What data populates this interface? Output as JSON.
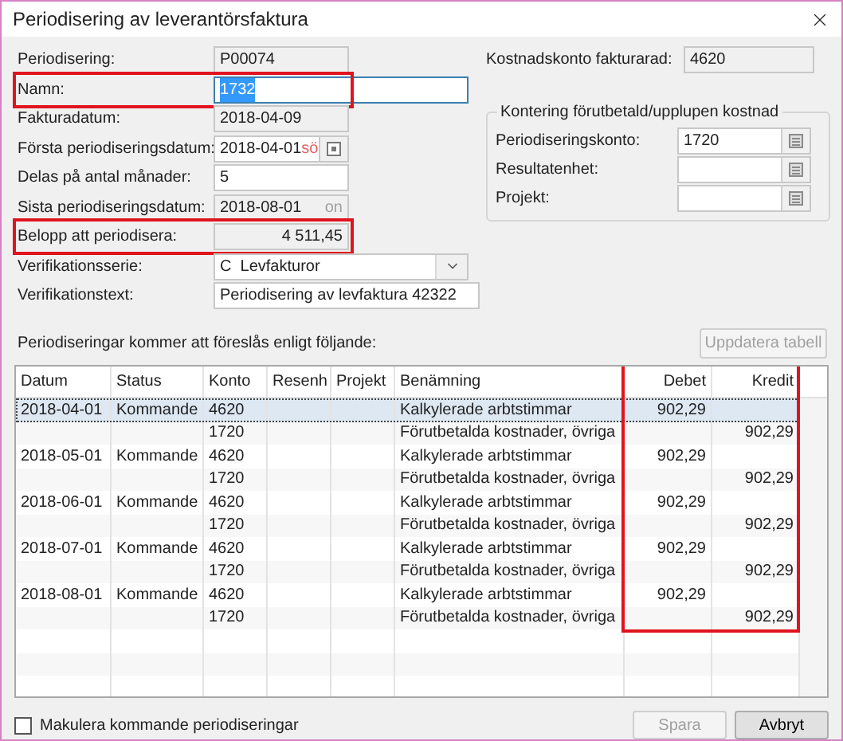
{
  "window": {
    "title": "Periodisering av leverantörsfaktura"
  },
  "form": [
    {
      "label": "Periodisering:",
      "value": "P00074",
      "kind": "readonly",
      "highlighted": false
    },
    {
      "label": "Namn:",
      "value": "1732",
      "kind": "name",
      "text_selected": true,
      "highlighted": true
    },
    {
      "label": "Fakturadatum:",
      "value": "2018-04-09",
      "kind": "readonly",
      "highlighted": false
    },
    {
      "label": "Första periodiseringsdatum:",
      "value": "2018-04-01",
      "weekday": "sö",
      "kind": "date",
      "highlighted": false
    },
    {
      "label": "Delas på antal månader:",
      "value": "5",
      "kind": "number",
      "highlighted": false
    },
    {
      "label": "Sista periodiseringsdatum:",
      "value": "2018-08-01",
      "weekday": "on",
      "kind": "readonly_date",
      "highlighted": false
    },
    {
      "label": "Belopp att periodisera:",
      "value": "4 511,45",
      "kind": "amount",
      "highlighted": true
    },
    {
      "label": "Verifikationsserie:",
      "value": "C  Levfakturor",
      "kind": "select",
      "highlighted": false
    },
    {
      "label": "Verifikationstext:",
      "value": "Periodisering av levfaktura 42322",
      "kind": "text",
      "highlighted": false
    }
  ],
  "cost_account": {
    "label": "Kostnadskonto fakturarad:",
    "value": "4620"
  },
  "group": {
    "title": "Kontering förutbetald/upplupen kostnad",
    "fields": [
      {
        "label": "Periodiseringskonto:",
        "value": "1720"
      },
      {
        "label": "Resultatenhet:"
      },
      {
        "label": "Projekt:"
      }
    ]
  },
  "table": {
    "caption": "Periodiseringar kommer att föreslås enligt följande:",
    "update_button": {
      "label": "Uppdatera tabell",
      "disabled": true
    },
    "columns": [
      {
        "label": "Datum",
        "kind": "text",
        "highlighted": false
      },
      {
        "label": "Status",
        "kind": "text",
        "highlighted": false
      },
      {
        "label": "Konto",
        "kind": "text",
        "highlighted": false
      },
      {
        "label": "Resenh",
        "kind": "text",
        "highlighted": false
      },
      {
        "label": "Projekt",
        "kind": "text",
        "highlighted": false
      },
      {
        "label": "Benämning",
        "kind": "text",
        "highlighted": false
      },
      {
        "label": "Debet",
        "kind": "amount",
        "highlighted": true
      },
      {
        "label": "Kredit",
        "kind": "amount",
        "highlighted": true
      }
    ],
    "rows": [
      {
        "selected": true,
        "cells": [
          "2018-04-01",
          "Kommande",
          "4620",
          null,
          null,
          "Kalkylerade arbtstimmar",
          "902,29",
          null
        ]
      },
      {
        "selected": false,
        "cells": [
          null,
          null,
          "1720",
          null,
          null,
          "Förutbetalda kostnader, övriga",
          null,
          "902,29"
        ]
      },
      {
        "selected": false,
        "cells": [
          "2018-05-01",
          "Kommande",
          "4620",
          null,
          null,
          "Kalkylerade arbtstimmar",
          "902,29",
          null
        ]
      },
      {
        "selected": false,
        "cells": [
          null,
          null,
          "1720",
          null,
          null,
          "Förutbetalda kostnader, övriga",
          null,
          "902,29"
        ]
      },
      {
        "selected": false,
        "cells": [
          "2018-06-01",
          "Kommande",
          "4620",
          null,
          null,
          "Kalkylerade arbtstimmar",
          "902,29",
          null
        ]
      },
      {
        "selected": false,
        "cells": [
          null,
          null,
          "1720",
          null,
          null,
          "Förutbetalda kostnader, övriga",
          null,
          "902,29"
        ]
      },
      {
        "selected": false,
        "cells": [
          "2018-07-01",
          "Kommande",
          "4620",
          null,
          null,
          "Kalkylerade arbtstimmar",
          "902,29",
          null
        ]
      },
      {
        "selected": false,
        "cells": [
          null,
          null,
          "1720",
          null,
          null,
          "Förutbetalda kostnader, övriga",
          null,
          "902,29"
        ]
      },
      {
        "selected": false,
        "cells": [
          "2018-08-01",
          "Kommande",
          "4620",
          null,
          null,
          "Kalkylerade arbtstimmar",
          "902,29",
          null
        ]
      },
      {
        "selected": false,
        "cells": [
          null,
          null,
          "1720",
          null,
          null,
          "Förutbetalda kostnader, övriga",
          null,
          "902,29"
        ]
      }
    ]
  },
  "footer": {
    "checkbox": {
      "label": "Makulera kommande periodiseringar",
      "checked": false
    },
    "buttons": [
      {
        "label": "Spara",
        "disabled": true
      },
      {
        "label": "Avbryt",
        "disabled": false
      }
    ]
  }
}
